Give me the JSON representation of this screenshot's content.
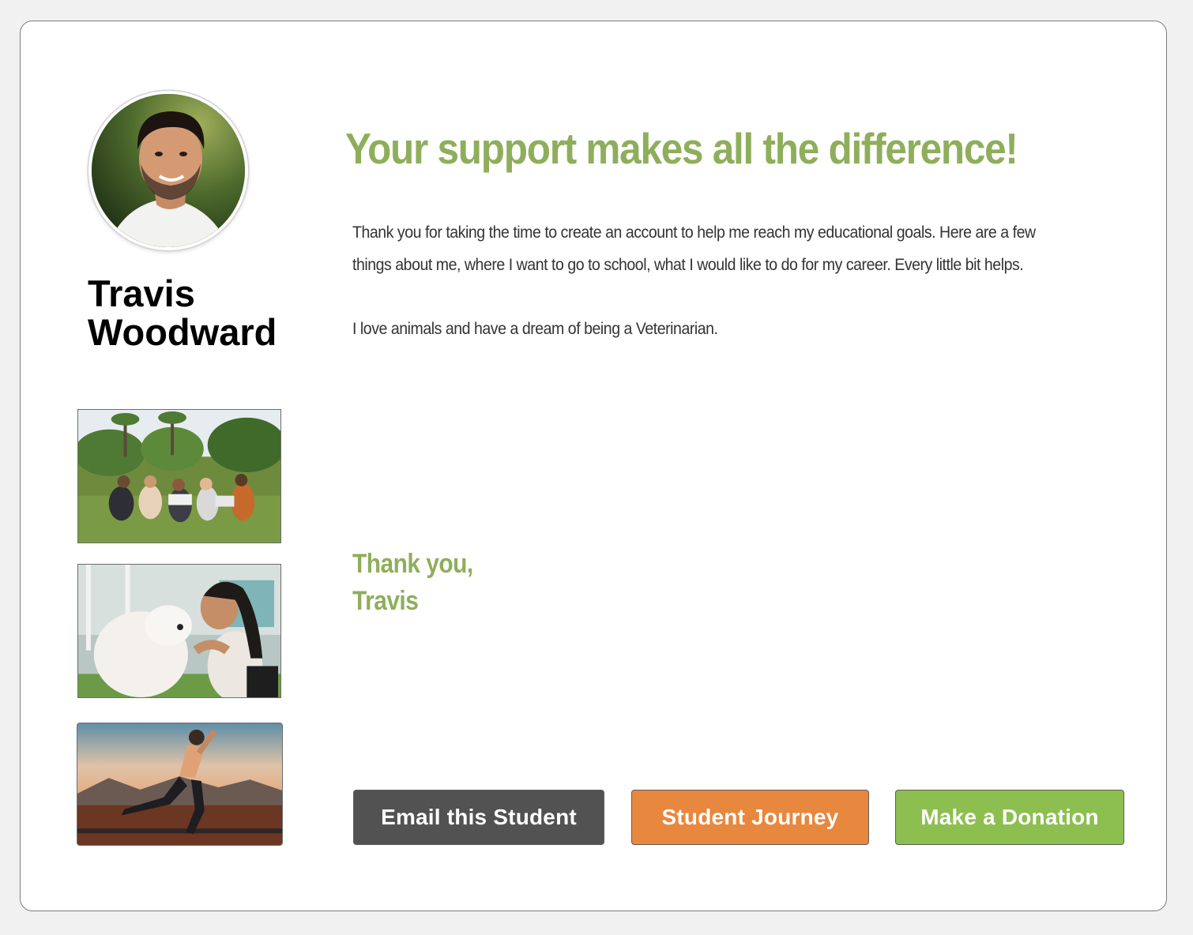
{
  "student": {
    "first_name": "Travis",
    "last_name": "Woodward"
  },
  "headline": "Your support makes all the difference!",
  "message": {
    "paragraph_1": "Thank you for taking the time to create an account to help me reach my educational goals. Here are a few things about me, where I want to go to school, what I would like to do for my career. Every little bit helps.",
    "paragraph_2": "I love animals and have a dream of being a Veterinarian."
  },
  "signoff": {
    "line_1": "Thank you,",
    "line_2": "Travis"
  },
  "buttons": {
    "email_label": "Email this Student",
    "journey_label": "Student Journey",
    "donate_label": "Make a Donation"
  },
  "colors": {
    "accent_green": "#8fae5c",
    "email_button": "#525252",
    "journey_button": "#e8873e",
    "donate_button": "#8cbf4f"
  }
}
